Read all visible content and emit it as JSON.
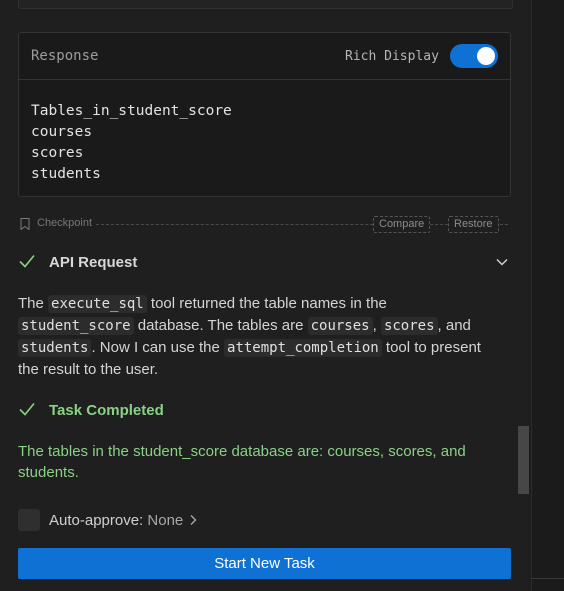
{
  "response": {
    "title": "Response",
    "rich_display_label": "Rich Display",
    "rich_display_on": true,
    "lines": [
      "Tables_in_student_score",
      "courses",
      "scores",
      "students"
    ]
  },
  "checkpoint": {
    "label": "Checkpoint",
    "compare_label": "Compare",
    "restore_label": "Restore"
  },
  "api_request": {
    "title": "API Request",
    "text_parts": {
      "p1": "The ",
      "c1": "execute_sql",
      "p2": " tool returned the table names in the ",
      "c2": "student_score",
      "p3": " database. The tables are ",
      "c3": "courses",
      "p4": ", ",
      "c4": "scores",
      "p5": ", and ",
      "c5": "students",
      "p6": ". Now I can use the ",
      "c6": "attempt_completion",
      "p7": " tool to present the result to the user."
    }
  },
  "task": {
    "title": "Task Completed",
    "text": "The tables in the student_score database are: courses, scores, and students."
  },
  "auto_approve": {
    "label": "Auto-approve:",
    "value": "None"
  },
  "start_button": {
    "label": "Start New Task"
  },
  "colors": {
    "accent": "#0e71d3",
    "success": "#89d185",
    "background": "#1f1f1f"
  },
  "icons": [
    "bookmark-icon",
    "check-icon",
    "chevron-down-icon",
    "chevron-right-icon"
  ]
}
